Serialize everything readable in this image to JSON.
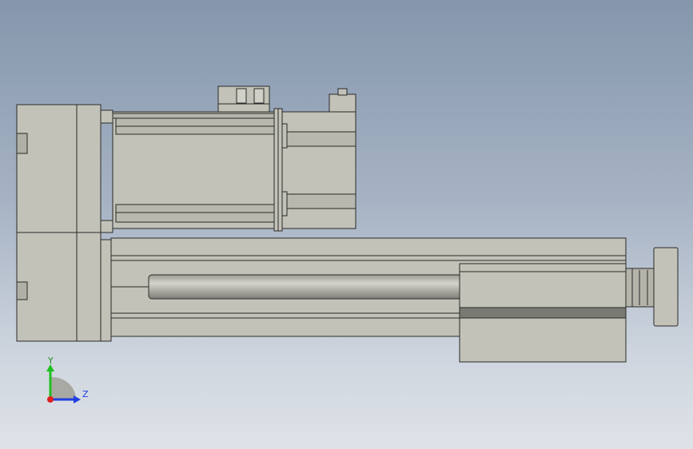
{
  "viewport": {
    "part_fill": "#c2c2b8",
    "part_dark": "#8f8f88",
    "edge_color": "#2a2a2a"
  },
  "triad": {
    "y_label": "Y",
    "z_label": "Z",
    "y_color": "#1fbf1f",
    "z_color": "#1f3fe0",
    "x_color": "#e01f1f"
  }
}
